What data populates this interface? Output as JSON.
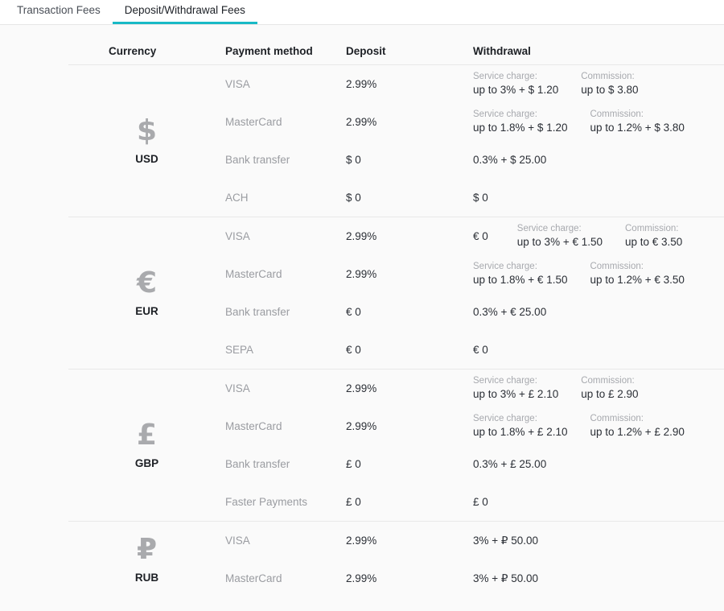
{
  "tabs": [
    {
      "label": "Transaction Fees",
      "active": false
    },
    {
      "label": "Deposit/Withdrawal Fees",
      "active": true
    }
  ],
  "accent_color": "#18b9c6",
  "table": {
    "headers": {
      "currency": "Currency",
      "payment_method": "Payment method",
      "deposit": "Deposit",
      "withdrawal": "Withdrawal"
    },
    "service_charge_label": "Service charge:",
    "commission_label": "Commission:",
    "groups": [
      {
        "symbol": "$",
        "code": "USD",
        "rows": [
          {
            "method": "VISA",
            "deposit": "2.99%",
            "withdrawal": {
              "type": "split",
              "lead": null,
              "service_charge": "up to 3% + $ 1.20",
              "commission": "up to $ 3.80"
            }
          },
          {
            "method": "MasterCard",
            "deposit": "2.99%",
            "withdrawal": {
              "type": "split",
              "lead": null,
              "service_charge": "up to 1.8% + $ 1.20",
              "commission": "up to 1.2% + $ 3.80"
            }
          },
          {
            "method": "Bank transfer",
            "deposit": "$ 0",
            "withdrawal": {
              "type": "plain",
              "value": "0.3% + $ 25.00"
            }
          },
          {
            "method": "ACH",
            "deposit": "$ 0",
            "withdrawal": {
              "type": "plain",
              "value": "$ 0"
            }
          }
        ]
      },
      {
        "symbol": "€",
        "code": "EUR",
        "rows": [
          {
            "method": "VISA",
            "deposit": "2.99%",
            "withdrawal": {
              "type": "split",
              "lead": "€ 0",
              "service_charge": "up to 3% + € 1.50",
              "commission": "up to € 3.50"
            }
          },
          {
            "method": "MasterCard",
            "deposit": "2.99%",
            "withdrawal": {
              "type": "split",
              "lead": null,
              "service_charge": "up to 1.8% + € 1.50",
              "commission": "up to 1.2% + € 3.50"
            }
          },
          {
            "method": "Bank transfer",
            "deposit": "€ 0",
            "withdrawal": {
              "type": "plain",
              "value": "0.3% + € 25.00"
            }
          },
          {
            "method": "SEPA",
            "deposit": "€ 0",
            "withdrawal": {
              "type": "plain",
              "value": "€ 0"
            }
          }
        ]
      },
      {
        "symbol": "£",
        "code": "GBP",
        "rows": [
          {
            "method": "VISA",
            "deposit": "2.99%",
            "withdrawal": {
              "type": "split",
              "lead": null,
              "service_charge": "up to 3% + £ 2.10",
              "commission": "up to £ 2.90"
            }
          },
          {
            "method": "MasterCard",
            "deposit": "2.99%",
            "withdrawal": {
              "type": "split",
              "lead": null,
              "service_charge": "up to 1.8% + £ 2.10",
              "commission": "up to 1.2% + £ 2.90"
            }
          },
          {
            "method": "Bank transfer",
            "deposit": "£ 0",
            "withdrawal": {
              "type": "plain",
              "value": "0.3% + £ 25.00"
            }
          },
          {
            "method": "Faster Payments",
            "deposit": "£ 0",
            "withdrawal": {
              "type": "plain",
              "value": "£ 0"
            }
          }
        ]
      },
      {
        "symbol": "₽",
        "code": "RUB",
        "rows": [
          {
            "method": "VISA",
            "deposit": "2.99%",
            "withdrawal": {
              "type": "plain",
              "value": "3% + ₽ 50.00"
            }
          },
          {
            "method": "MasterCard",
            "deposit": "2.99%",
            "withdrawal": {
              "type": "plain",
              "value": "3% + ₽ 50.00"
            }
          }
        ]
      }
    ]
  }
}
